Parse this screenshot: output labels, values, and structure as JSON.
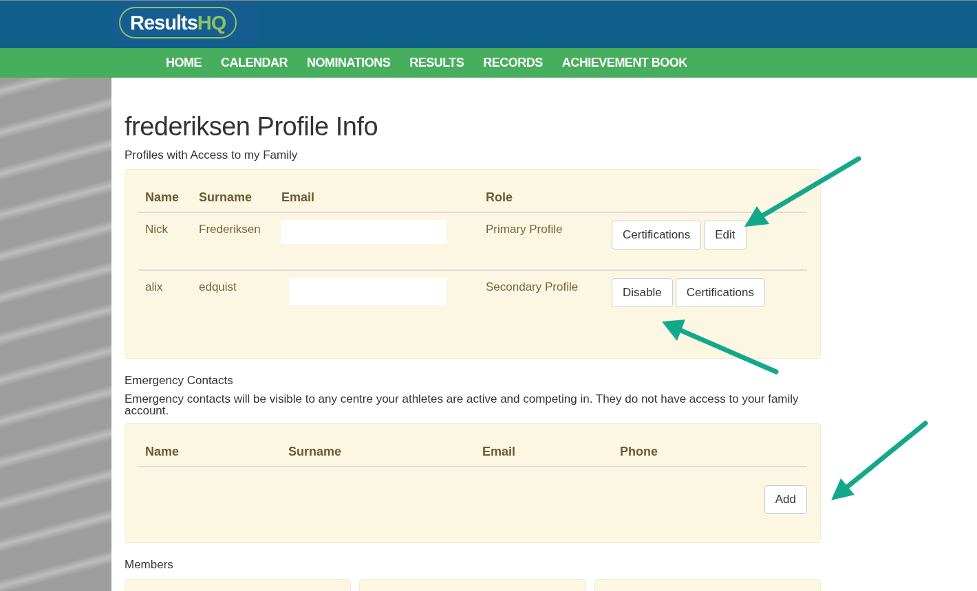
{
  "logo": {
    "text": "Results",
    "accent": "HQ"
  },
  "nav": [
    {
      "label": "HOME"
    },
    {
      "label": "CALENDAR"
    },
    {
      "label": "NOMINATIONS"
    },
    {
      "label": "RESULTS"
    },
    {
      "label": "RECORDS"
    },
    {
      "label": "ACHIEVEMENT BOOK"
    }
  ],
  "title": "frederiksen Profile Info",
  "access": {
    "heading": "Profiles with Access to my Family",
    "columns": [
      "Name",
      "Surname",
      "Email",
      "Role"
    ],
    "rows": [
      {
        "name": "Nick",
        "surname": "Frederiksen",
        "role": "Primary Profile",
        "buttons": [
          "Certifications",
          "Edit"
        ]
      },
      {
        "name": "alix",
        "surname": "edquist",
        "role": "Secondary Profile",
        "buttons": [
          "Disable",
          "Certifications"
        ]
      }
    ]
  },
  "emergency": {
    "heading": "Emergency Contacts",
    "note": "Emergency contacts will be visible to any centre your athletes are active and competing in. They do not have access to your family account.",
    "columns": [
      "Name",
      "Surname",
      "Email",
      "Phone"
    ],
    "add_button": "Add"
  },
  "members": {
    "heading": "Members"
  }
}
